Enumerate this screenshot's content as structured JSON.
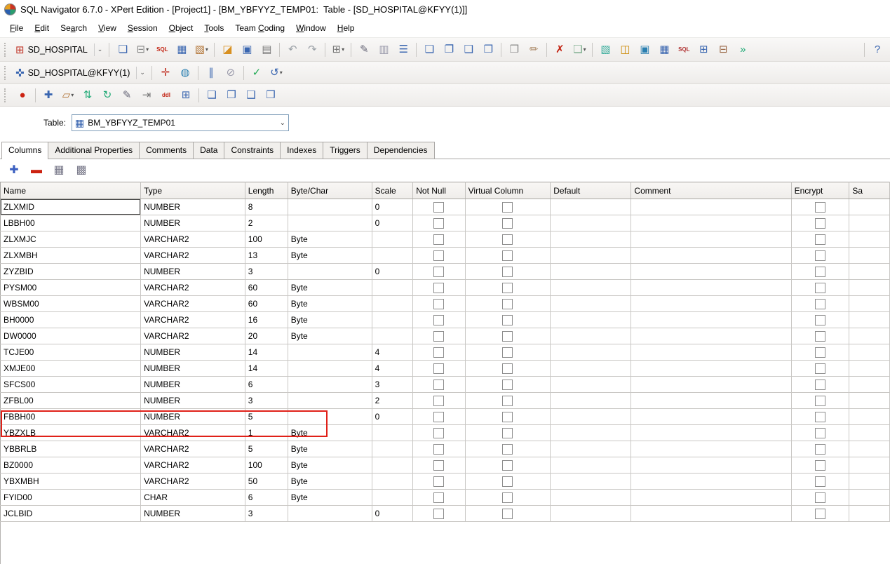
{
  "window": {
    "title": "SQL Navigator 6.7.0 - XPert Edition - [Project1] - [BM_YBFYYZ_TEMP01:  Table - [SD_HOSPITAL@KFYY(1)]]"
  },
  "menu": {
    "items": [
      {
        "label": "File",
        "accel": 0
      },
      {
        "label": "Edit",
        "accel": 0
      },
      {
        "label": "Search",
        "accel": 2
      },
      {
        "label": "View",
        "accel": 0
      },
      {
        "label": "Session",
        "accel": 0
      },
      {
        "label": "Object",
        "accel": 0
      },
      {
        "label": "Tools",
        "accel": 0
      },
      {
        "label": "Team Coding",
        "accel": 5
      },
      {
        "label": "Window",
        "accel": 0
      },
      {
        "label": "Help",
        "accel": 0
      }
    ]
  },
  "toolbar_session": {
    "label": "SD_HOSPITAL",
    "icon": {
      "name": "session-icon",
      "glyph": "⊞",
      "color": "#c03326"
    }
  },
  "toolbar_connection": {
    "label": "SD_HOSPITAL@KFYY(1)",
    "icon": {
      "name": "connection-icon",
      "glyph": "✜",
      "color": "#3a66b0"
    }
  },
  "toolbars": {
    "main": [
      {
        "name": "new-session-icon",
        "glyph": "❏",
        "color": "#3a66b0"
      },
      {
        "name": "commit-dropdown-icon",
        "glyph": "⊟",
        "color": "#888888",
        "dropdown": true
      },
      {
        "name": "sql-statement-icon",
        "glyph": "SQL",
        "color": "#c22211",
        "small": true
      },
      {
        "name": "data-grid-icon",
        "glyph": "▦",
        "color": "#3a66b0"
      },
      {
        "name": "visual-output-dropdown-icon",
        "glyph": "▧",
        "color": "#b07030",
        "dropdown": true
      },
      {
        "sep": true
      },
      {
        "name": "open-file-icon",
        "glyph": "◪",
        "color": "#d89020"
      },
      {
        "name": "save-file-icon",
        "glyph": "▣",
        "color": "#3a66b0"
      },
      {
        "name": "print-icon",
        "glyph": "▤",
        "color": "#777777"
      },
      {
        "sep": true
      },
      {
        "name": "undo-icon",
        "glyph": "↶",
        "color": "#9aa0a6"
      },
      {
        "name": "redo-icon",
        "glyph": "↷",
        "color": "#9aa0a6"
      },
      {
        "sep": true
      },
      {
        "name": "code-grid-dropdown-icon",
        "glyph": "⊞",
        "color": "#777777",
        "dropdown": true
      },
      {
        "sep": true
      },
      {
        "name": "describe-icon",
        "glyph": "✎",
        "color": "#666677"
      },
      {
        "name": "paste-icon",
        "glyph": "▥",
        "color": "#9999aa"
      },
      {
        "name": "indent-icon",
        "glyph": "☰",
        "color": "#3a66b0"
      },
      {
        "sep": true
      },
      {
        "name": "copy-object-icon",
        "glyph": "❏",
        "color": "#3a66b0"
      },
      {
        "name": "view-object-icon",
        "glyph": "❐",
        "color": "#3a66b0"
      },
      {
        "name": "promote-object-icon",
        "glyph": "❑",
        "color": "#3a66b0"
      },
      {
        "name": "edit-object-icon",
        "glyph": "❒",
        "color": "#3a66b0"
      },
      {
        "sep": true
      },
      {
        "name": "compile-icon",
        "glyph": "❒",
        "color": "#888888"
      },
      {
        "name": "format-brush-icon",
        "glyph": "✏",
        "color": "#aa8866"
      },
      {
        "sep": true
      },
      {
        "name": "syntax-check-icon",
        "glyph": "✗",
        "color": "#c22211"
      },
      {
        "name": "code-analysis-dropdown-icon",
        "glyph": "❏",
        "color": "#77aa88",
        "dropdown": true
      },
      {
        "sep": true
      },
      {
        "name": "image-icon",
        "glyph": "▧",
        "color": "#33aa99"
      },
      {
        "name": "web-publish-icon",
        "glyph": "◫",
        "color": "#cc8800"
      },
      {
        "name": "output-monitor-icon",
        "glyph": "▣",
        "color": "#2a7fb0"
      },
      {
        "name": "grid-result-icon",
        "glyph": "▦",
        "color": "#3a66b0"
      },
      {
        "name": "sql-log-icon",
        "glyph": "SQL",
        "color": "#b03333",
        "small": true
      },
      {
        "name": "session-browser-icon",
        "glyph": "⊞",
        "color": "#3a66b0"
      },
      {
        "name": "object-compare-icon",
        "glyph": "⊟",
        "color": "#996644"
      },
      {
        "name": "fast-run-icon",
        "glyph": "»",
        "color": "#22aa77"
      },
      {
        "sep": true,
        "push": true
      },
      {
        "name": "help-icon",
        "glyph": "?",
        "color": "#3a66b0"
      }
    ],
    "connection": [
      {
        "name": "test-connection-icon",
        "glyph": "✛",
        "color": "#c03326"
      },
      {
        "name": "web-browser-icon",
        "glyph": "◍",
        "color": "#2a7fb0"
      },
      {
        "sep": true
      },
      {
        "name": "pause-icon",
        "glyph": "∥",
        "color": "#3a66b0"
      },
      {
        "name": "stop-icon",
        "glyph": "⊘",
        "color": "#9999aa"
      },
      {
        "sep": true
      },
      {
        "name": "commit-all-icon",
        "glyph": "✓",
        "color": "#22aa55"
      },
      {
        "name": "rollback-dropdown-icon",
        "glyph": "↺",
        "color": "#3a66b0",
        "dropdown": true
      }
    ],
    "object": [
      {
        "name": "record-edits-icon",
        "glyph": "●",
        "color": "#cc2211"
      },
      {
        "sep": true
      },
      {
        "name": "add-item-icon",
        "glyph": "✚",
        "color": "#3a66b0"
      },
      {
        "name": "session-list-dropdown-icon",
        "glyph": "▱",
        "color": "#b07030",
        "dropdown": true
      },
      {
        "name": "reorder-icon",
        "glyph": "⇅",
        "color": "#22aa77"
      },
      {
        "name": "refresh-icon",
        "glyph": "↻",
        "color": "#22aa77"
      },
      {
        "name": "edit-sql-icon",
        "glyph": "✎",
        "color": "#666677"
      },
      {
        "name": "go-to-icon",
        "glyph": "⇥",
        "color": "#777777"
      },
      {
        "name": "show-ddl-icon",
        "glyph": "ddl",
        "color": "#c22211",
        "small": true
      },
      {
        "name": "new-window-icon",
        "glyph": "⊞",
        "color": "#3a66b0"
      },
      {
        "sep": true
      },
      {
        "name": "copy-object-icon",
        "glyph": "❏",
        "color": "#3a66b0"
      },
      {
        "name": "view-object-icon",
        "glyph": "❐",
        "color": "#3a66b0"
      },
      {
        "name": "promote-object-icon",
        "glyph": "❑",
        "color": "#3a66b0"
      },
      {
        "name": "edit-object-icon",
        "glyph": "❒",
        "color": "#3a66b0"
      }
    ],
    "grid_tools": [
      {
        "name": "add-column-icon",
        "glyph": "✚",
        "color": "#3a5fc0"
      },
      {
        "name": "remove-column-icon",
        "glyph": "▬",
        "color": "#cc2211"
      },
      {
        "name": "grid-view-icon",
        "glyph": "▦",
        "color": "#777788"
      },
      {
        "name": "column-organizer-icon",
        "glyph": "▩",
        "color": "#777788"
      }
    ]
  },
  "table_selector": {
    "label": "Table:",
    "value": "BM_YBFYYZ_TEMP01",
    "icon": {
      "name": "table-icon",
      "glyph": "▦",
      "color": "#3a66b0"
    }
  },
  "tabs": {
    "items": [
      "Columns",
      "Additional Properties",
      "Comments",
      "Data",
      "Constraints",
      "Indexes",
      "Triggers",
      "Dependencies"
    ],
    "active": "Columns"
  },
  "grid": {
    "columns": [
      "Name",
      "Type",
      "Length",
      "Byte/Char",
      "Scale",
      "Not Null",
      "Virtual Column",
      "Default",
      "Comment",
      "Encrypt",
      "Sa"
    ],
    "checkbox_columns": [
      "Not Null",
      "Virtual Column",
      "Encrypt"
    ],
    "all_checkboxes_unchecked": true,
    "rows": [
      {
        "name": "ZLXMID",
        "type": "NUMBER",
        "length": "8",
        "byte_char": "",
        "scale": "0"
      },
      {
        "name": "LBBH00",
        "type": "NUMBER",
        "length": "2",
        "byte_char": "",
        "scale": "0"
      },
      {
        "name": "ZLXMJC",
        "type": "VARCHAR2",
        "length": "100",
        "byte_char": "Byte",
        "scale": ""
      },
      {
        "name": "ZLXMBH",
        "type": "VARCHAR2",
        "length": "13",
        "byte_char": "Byte",
        "scale": ""
      },
      {
        "name": "ZYZBID",
        "type": "NUMBER",
        "length": "3",
        "byte_char": "",
        "scale": "0"
      },
      {
        "name": "PYSM00",
        "type": "VARCHAR2",
        "length": "60",
        "byte_char": "Byte",
        "scale": ""
      },
      {
        "name": "WBSM00",
        "type": "VARCHAR2",
        "length": "60",
        "byte_char": "Byte",
        "scale": ""
      },
      {
        "name": "BH0000",
        "type": "VARCHAR2",
        "length": "16",
        "byte_char": "Byte",
        "scale": ""
      },
      {
        "name": "DW0000",
        "type": "VARCHAR2",
        "length": "20",
        "byte_char": "Byte",
        "scale": ""
      },
      {
        "name": "TCJE00",
        "type": "NUMBER",
        "length": "14",
        "byte_char": "",
        "scale": "4"
      },
      {
        "name": "XMJE00",
        "type": "NUMBER",
        "length": "14",
        "byte_char": "",
        "scale": "4"
      },
      {
        "name": "SFCS00",
        "type": "NUMBER",
        "length": "6",
        "byte_char": "",
        "scale": "3"
      },
      {
        "name": "ZFBL00",
        "type": "NUMBER",
        "length": "3",
        "byte_char": "",
        "scale": "2"
      },
      {
        "name": "FBBH00",
        "type": "NUMBER",
        "length": "5",
        "byte_char": "",
        "scale": "0"
      },
      {
        "name": "YBZXLB",
        "type": "VARCHAR2",
        "length": "1",
        "byte_char": "Byte",
        "scale": ""
      },
      {
        "name": "YBBRLB",
        "type": "VARCHAR2",
        "length": "5",
        "byte_char": "Byte",
        "scale": ""
      },
      {
        "name": "BZ0000",
        "type": "VARCHAR2",
        "length": "100",
        "byte_char": "Byte",
        "scale": ""
      },
      {
        "name": "YBXMBH",
        "type": "VARCHAR2",
        "length": "50",
        "byte_char": "Byte",
        "scale": ""
      },
      {
        "name": "FYID00",
        "type": "CHAR",
        "length": "6",
        "byte_char": "Byte",
        "scale": ""
      },
      {
        "name": "JCLBID",
        "type": "NUMBER",
        "length": "3",
        "byte_char": "",
        "scale": "0"
      }
    ]
  },
  "annotation": {
    "type": "red-rectangle",
    "highlighted_row": "YBBRLB",
    "color": "#e02018"
  }
}
